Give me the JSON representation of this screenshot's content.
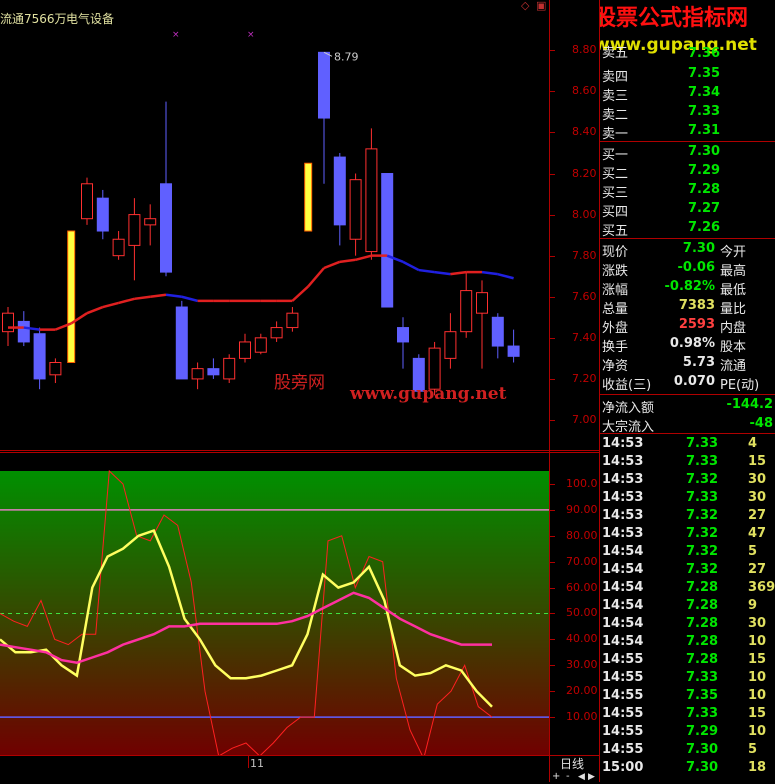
{
  "header": {
    "float_shares": "流通7566万",
    "sector": "电气设备"
  },
  "watermark_top": {
    "title": "股票公式指标网",
    "url": "www.gupang.net",
    "partial_label": "卖五"
  },
  "watermark_chart": {
    "cn": "股旁网",
    "url": "www.gupang.net"
  },
  "colors": {
    "up": "#ff3030",
    "down": "#6060ff",
    "limit": "#ffff40",
    "price_green": "#00e600",
    "volume_yellow": "#e0e060"
  },
  "price_axis": {
    "ticks": [
      "8.80",
      "8.60",
      "8.40",
      "8.20",
      "8.00",
      "7.80",
      "7.60",
      "7.40",
      "7.20",
      "7.00"
    ],
    "high_marker": "8.79"
  },
  "indicator_axis": {
    "ticks": [
      "100.0",
      "90.00",
      "80.00",
      "70.00",
      "60.00",
      "50.00",
      "40.00",
      "30.00",
      "20.00",
      "10.00"
    ]
  },
  "bottom_axis": {
    "date_label": "11",
    "period_label": "日线"
  },
  "chart_data": [
    {
      "type": "candlestick",
      "title": "",
      "ylim": [
        7.0,
        8.85
      ],
      "candles": [
        {
          "o": 7.43,
          "c": 7.52,
          "h": 7.55,
          "l": 7.36
        },
        {
          "o": 7.48,
          "c": 7.38,
          "h": 7.53,
          "l": 7.36
        },
        {
          "o": 7.42,
          "c": 7.2,
          "h": 7.45,
          "l": 7.15
        },
        {
          "o": 7.22,
          "c": 7.28,
          "h": 7.3,
          "l": 7.18
        },
        {
          "o": 7.28,
          "c": 7.92,
          "h": 7.92,
          "l": 7.28
        },
        {
          "o": 7.98,
          "c": 8.15,
          "h": 8.18,
          "l": 7.95
        },
        {
          "o": 8.08,
          "c": 7.92,
          "h": 8.12,
          "l": 7.88
        },
        {
          "o": 7.8,
          "c": 7.88,
          "h": 7.92,
          "l": 7.78
        },
        {
          "o": 7.85,
          "c": 8.0,
          "h": 8.08,
          "l": 7.68
        },
        {
          "o": 7.95,
          "c": 7.98,
          "h": 8.05,
          "l": 7.85
        },
        {
          "o": 8.15,
          "c": 7.72,
          "h": 8.55,
          "l": 7.7
        },
        {
          "o": 7.55,
          "c": 7.2,
          "h": 7.58,
          "l": 7.2
        },
        {
          "o": 7.2,
          "c": 7.25,
          "h": 7.28,
          "l": 7.15
        },
        {
          "o": 7.25,
          "c": 7.22,
          "h": 7.3,
          "l": 7.2
        },
        {
          "o": 7.2,
          "c": 7.3,
          "h": 7.32,
          "l": 7.18
        },
        {
          "o": 7.3,
          "c": 7.38,
          "h": 7.42,
          "l": 7.28
        },
        {
          "o": 7.33,
          "c": 7.4,
          "h": 7.42,
          "l": 7.32
        },
        {
          "o": 7.4,
          "c": 7.45,
          "h": 7.48,
          "l": 7.38
        },
        {
          "o": 7.45,
          "c": 7.52,
          "h": 7.55,
          "l": 7.43
        },
        {
          "o": 7.92,
          "c": 8.25,
          "h": 8.25,
          "l": 7.92
        },
        {
          "o": 8.79,
          "c": 8.47,
          "h": 8.79,
          "l": 8.15
        },
        {
          "o": 8.28,
          "c": 7.95,
          "h": 8.3,
          "l": 7.85
        },
        {
          "o": 7.88,
          "c": 8.17,
          "h": 8.2,
          "l": 7.8
        },
        {
          "o": 7.82,
          "c": 8.32,
          "h": 8.42,
          "l": 7.78
        },
        {
          "o": 8.2,
          "c": 7.55,
          "h": 8.2,
          "l": 7.55
        },
        {
          "o": 7.45,
          "c": 7.38,
          "h": 7.5,
          "l": 7.25
        },
        {
          "o": 7.3,
          "c": 7.14,
          "h": 7.32,
          "l": 7.14
        },
        {
          "o": 7.15,
          "c": 7.35,
          "h": 7.38,
          "l": 7.12
        },
        {
          "o": 7.3,
          "c": 7.43,
          "h": 7.52,
          "l": 7.25
        },
        {
          "o": 7.43,
          "c": 7.63,
          "h": 7.72,
          "l": 7.4
        },
        {
          "o": 7.52,
          "c": 7.62,
          "h": 7.68,
          "l": 7.25
        },
        {
          "o": 7.5,
          "c": 7.36,
          "h": 7.52,
          "l": 7.3
        },
        {
          "o": 7.36,
          "c": 7.31,
          "h": 7.44,
          "l": 7.28
        }
      ],
      "ma_values": [
        7.45,
        7.45,
        7.44,
        7.44,
        7.47,
        7.52,
        7.55,
        7.57,
        7.59,
        7.6,
        7.61,
        7.6,
        7.58,
        7.58,
        7.58,
        7.58,
        7.58,
        7.58,
        7.58,
        7.65,
        7.74,
        7.77,
        7.78,
        7.8,
        7.8,
        7.77,
        7.73,
        7.72,
        7.71,
        7.72,
        7.72,
        7.71,
        7.69
      ]
    },
    {
      "type": "line",
      "title": "",
      "ylim": [
        0,
        105
      ],
      "reference_lines": [
        90,
        50,
        10
      ],
      "series": [
        {
          "color": "#ff2020",
          "values": [
            50,
            47,
            45,
            55,
            40,
            38,
            42,
            42,
            105,
            100,
            80,
            78,
            88,
            84,
            62,
            20,
            -5,
            -2,
            0,
            -5,
            0,
            6,
            10,
            10,
            78,
            80,
            60,
            72,
            70,
            25,
            5,
            -6,
            15,
            20,
            30,
            14,
            10
          ]
        },
        {
          "color": "#ffff60",
          "values": [
            40,
            35,
            35,
            36,
            30,
            26,
            60,
            72,
            75,
            80,
            82,
            68,
            48,
            40,
            30,
            25,
            25,
            26,
            28,
            30,
            42,
            65,
            60,
            62,
            68,
            55,
            30,
            26,
            27,
            30,
            28,
            20,
            14
          ]
        },
        {
          "color": "#ff30a0",
          "values": [
            38,
            37,
            36,
            35,
            32,
            31,
            33,
            35,
            38,
            40,
            42,
            45,
            45,
            46,
            46,
            46,
            46,
            46,
            46,
            47,
            49,
            52,
            55,
            58,
            56,
            52,
            48,
            45,
            42,
            40,
            38,
            38,
            38
          ]
        }
      ]
    }
  ],
  "orderbook": {
    "sell": [
      {
        "label": "卖五",
        "price": "7.36",
        "vol": ""
      },
      {
        "label": "卖四",
        "price": "7.35",
        "vol": ""
      },
      {
        "label": "卖三",
        "price": "7.34",
        "vol": ""
      },
      {
        "label": "卖二",
        "price": "7.33",
        "vol": ""
      },
      {
        "label": "卖一",
        "price": "7.31",
        "vol": ""
      }
    ],
    "buy": [
      {
        "label": "买一",
        "price": "7.30",
        "vol": ""
      },
      {
        "label": "买二",
        "price": "7.29",
        "vol": ""
      },
      {
        "label": "买三",
        "price": "7.28",
        "vol": ""
      },
      {
        "label": "买四",
        "price": "7.27",
        "vol": ""
      },
      {
        "label": "买五",
        "price": "7.26",
        "vol": ""
      }
    ]
  },
  "stats": [
    {
      "label": "现价",
      "value": "7.30",
      "color": "green",
      "label2": "今开"
    },
    {
      "label": "涨跌",
      "value": "-0.06",
      "color": "green",
      "label2": "最高"
    },
    {
      "label": "涨幅",
      "value": "-0.82%",
      "color": "green",
      "label2": "最低"
    },
    {
      "label": "总量",
      "value": "7383",
      "color": "yellow",
      "label2": "量比"
    },
    {
      "label": "外盘",
      "value": "2593",
      "color": "red",
      "label2": "内盘"
    },
    {
      "label": "换手",
      "value": "0.98%",
      "color": "white",
      "label2": "股本"
    },
    {
      "label": "净资",
      "value": "5.73",
      "color": "white",
      "label2": "流通"
    },
    {
      "label": "收益(三)",
      "value": "0.070",
      "color": "white",
      "label2": "PE(动)"
    }
  ],
  "flows": [
    {
      "label": "净流入额",
      "value": "-144.2"
    },
    {
      "label": "大宗流入",
      "value": "-48"
    }
  ],
  "ticks": [
    {
      "time": "14:53",
      "price": "7.33",
      "vol": "4",
      "color": "green"
    },
    {
      "time": "14:53",
      "price": "7.33",
      "vol": "15",
      "color": "green"
    },
    {
      "time": "14:53",
      "price": "7.32",
      "vol": "30",
      "color": "green"
    },
    {
      "time": "14:53",
      "price": "7.33",
      "vol": "30",
      "color": "green"
    },
    {
      "time": "14:53",
      "price": "7.32",
      "vol": "27",
      "color": "green"
    },
    {
      "time": "14:53",
      "price": "7.32",
      "vol": "47",
      "color": "green"
    },
    {
      "time": "14:54",
      "price": "7.32",
      "vol": "5",
      "color": "green"
    },
    {
      "time": "14:54",
      "price": "7.32",
      "vol": "27",
      "color": "green"
    },
    {
      "time": "14:54",
      "price": "7.28",
      "vol": "369",
      "color": "green"
    },
    {
      "time": "14:54",
      "price": "7.28",
      "vol": "9",
      "color": "green"
    },
    {
      "time": "14:54",
      "price": "7.28",
      "vol": "30",
      "color": "green"
    },
    {
      "time": "14:54",
      "price": "7.28",
      "vol": "10",
      "color": "green"
    },
    {
      "time": "14:55",
      "price": "7.28",
      "vol": "15",
      "color": "green"
    },
    {
      "time": "14:55",
      "price": "7.33",
      "vol": "10",
      "color": "green"
    },
    {
      "time": "14:55",
      "price": "7.35",
      "vol": "10",
      "color": "green"
    },
    {
      "time": "14:55",
      "price": "7.33",
      "vol": "15",
      "color": "green"
    },
    {
      "time": "14:55",
      "price": "7.29",
      "vol": "10",
      "color": "green"
    },
    {
      "time": "14:55",
      "price": "7.30",
      "vol": "5",
      "color": "green"
    },
    {
      "time": "15:00",
      "price": "7.30",
      "vol": "18",
      "color": "green"
    }
  ]
}
